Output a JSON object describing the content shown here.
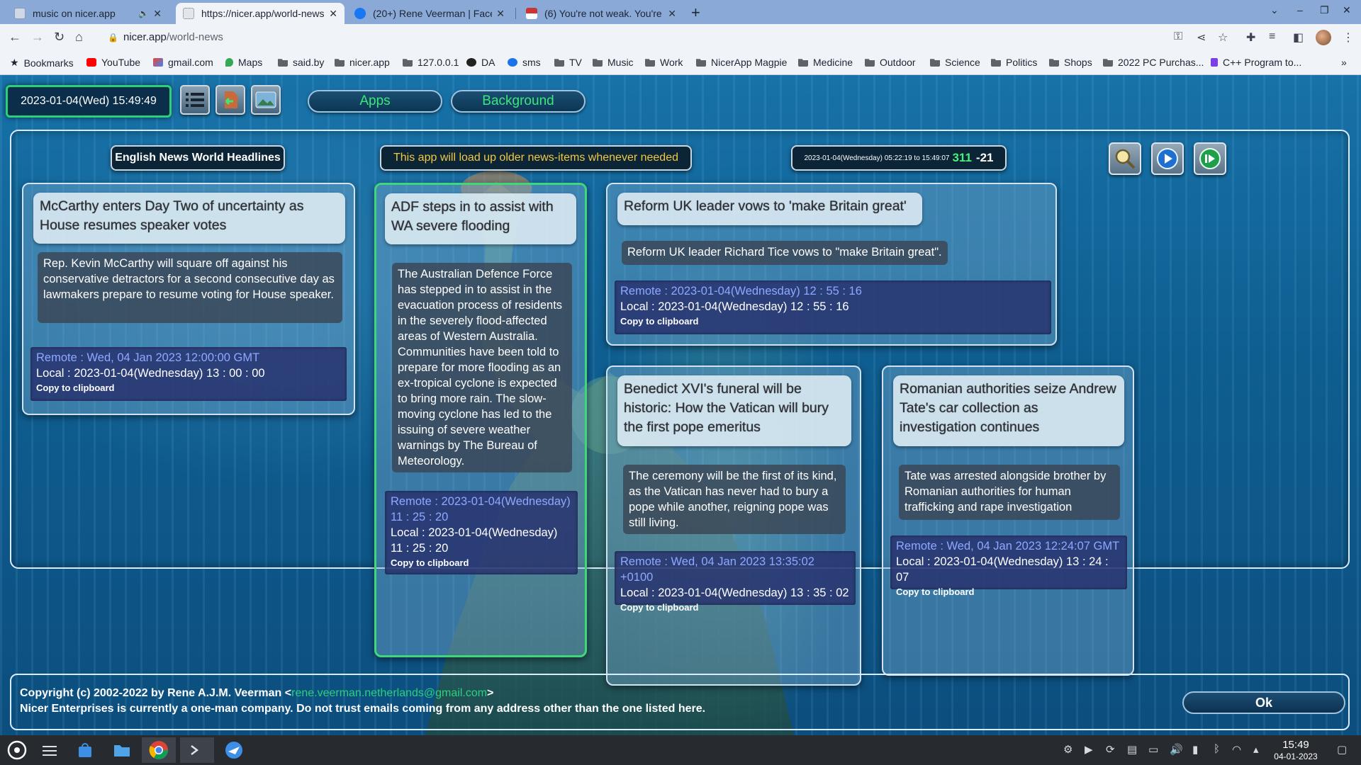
{
  "browser": {
    "tabs": [
      {
        "title": "music on nicer.app",
        "active": false
      },
      {
        "title": "https://nicer.app/world-news",
        "active": true
      },
      {
        "title": "(20+) Rene Veerman | Facebo",
        "active": false
      },
      {
        "title": "(6) You're not weak. You're ju",
        "active": false
      }
    ],
    "new_tab": "+",
    "window_controls": {
      "list": "⌄",
      "minimize": "–",
      "restore": "❐",
      "close": "✕"
    },
    "url_host": "nicer.app",
    "url_path": "/world-news",
    "bookmarks": [
      {
        "label": "Bookmarks",
        "icon": "star-icon"
      },
      {
        "label": "YouTube",
        "icon": "youtube-icon"
      },
      {
        "label": "gmail.com",
        "icon": "gmail-icon"
      },
      {
        "label": "Maps",
        "icon": "maps-icon"
      },
      {
        "label": "said.by",
        "icon": "folder-icon"
      },
      {
        "label": "nicer.app",
        "icon": "folder-icon"
      },
      {
        "label": "127.0.0.1",
        "icon": "folder-icon"
      },
      {
        "label": "DA",
        "icon": "github-icon"
      },
      {
        "label": "sms",
        "icon": "sms-icon"
      },
      {
        "label": "TV",
        "icon": "folder-icon"
      },
      {
        "label": "Music",
        "icon": "folder-icon"
      },
      {
        "label": "Work",
        "icon": "folder-icon"
      },
      {
        "label": "NicerApp Magpie",
        "icon": "folder-icon"
      },
      {
        "label": "Medicine",
        "icon": "folder-icon"
      },
      {
        "label": "Outdoor",
        "icon": "folder-icon"
      },
      {
        "label": "Science",
        "icon": "folder-icon"
      },
      {
        "label": "Politics",
        "icon": "folder-icon"
      },
      {
        "label": "Shops",
        "icon": "folder-icon"
      },
      {
        "label": "2022 PC Purchas...",
        "icon": "folder-icon"
      },
      {
        "label": "C++ Program to...",
        "icon": "cpp-icon"
      }
    ],
    "bookmarks_overflow": "»"
  },
  "site": {
    "clock": "2023-01-04(Wed) 15:49:49",
    "apps_label": "Apps",
    "background_label": "Background",
    "app_title": "English News World Headlines",
    "app_note": "This app will load up older news-items whenever needed",
    "stats_range": "2023-01-04(Wednesday) 05:22:19 to 15:49:07",
    "stats_count": "311",
    "stats_delta": "-21",
    "footer_copyright": "Copyright (c) 2002-2022 by Rene A.J.M. Veerman <",
    "footer_email": "rene.veerman.netherlands@gmail.com",
    "footer_close": ">",
    "footer_notice": "Nicer Enterprises is currently a one-man company. Do not trust emails coming from any address other than the one listed here.",
    "ok_label": "Ok",
    "colors": {
      "accent_green": "#2ad17a",
      "note_yellow": "#f2c843",
      "remote_blue": "#8fa8ff"
    }
  },
  "news": [
    {
      "title": "McCarthy enters Day Two of uncertainty as House resumes speaker votes",
      "description": "Rep. Kevin McCarthy will square off against his conservative detractors for a second consecutive day as lawmakers prepare to resume voting for House speaker.",
      "remote": "Remote : Wed, 04 Jan 2023 12:00:00 GMT",
      "local": "Local : 2023-01-04(Wednesday) 13 : 00 : 00",
      "copy": "Copy to clipboard"
    },
    {
      "title": "ADF steps in to assist with WA severe flooding",
      "description": "The Australian Defence Force has stepped in to assist in the evacuation process of residents in the severely flood-affected areas of Western Australia. Communities have been told to prepare for more flooding as an ex-tropical cyclone is expected to bring more rain. The slow-moving cyclone has led to the issuing of severe weather warnings by The Bureau of Meteorology.",
      "remote": "Remote : 2023-01-04(Wednesday) 11 : 25 : 20",
      "local": "Local : 2023-01-04(Wednesday) 11 : 25 : 20",
      "copy": "Copy to clipboard"
    },
    {
      "title": "Reform UK leader vows to 'make Britain great'",
      "description": "Reform UK leader Richard Tice vows to \"make Britain great\".",
      "remote": "Remote : 2023-01-04(Wednesday) 12 : 55 : 16",
      "local": "Local : 2023-01-04(Wednesday) 12 : 55 : 16",
      "copy": "Copy to clipboard"
    },
    {
      "title": "Benedict XVI's funeral will be historic: How the Vatican will bury the first pope emeritus",
      "description": "The ceremony will be the first of its kind, as the Vatican has never had to bury a pope while another, reigning pope was still living.",
      "remote": "Remote : Wed, 04 Jan 2023 13:35:02 +0100",
      "local": "Local : 2023-01-04(Wednesday) 13 : 35 : 02",
      "copy": "Copy to clipboard"
    },
    {
      "title": "Romanian authorities seize Andrew Tate's car collection as investigation continues",
      "description": "Tate was arrested alongside brother by Romanian authorities for human trafficking and rape investigation",
      "remote": "Remote : Wed, 04 Jan 2023 12:24:07 GMT",
      "local": "Local : 2023-01-04(Wednesday) 13 : 24 : 07",
      "copy": "Copy to clipboard"
    }
  ],
  "taskbar": {
    "time": "15:49",
    "date": "04-01-2023"
  }
}
